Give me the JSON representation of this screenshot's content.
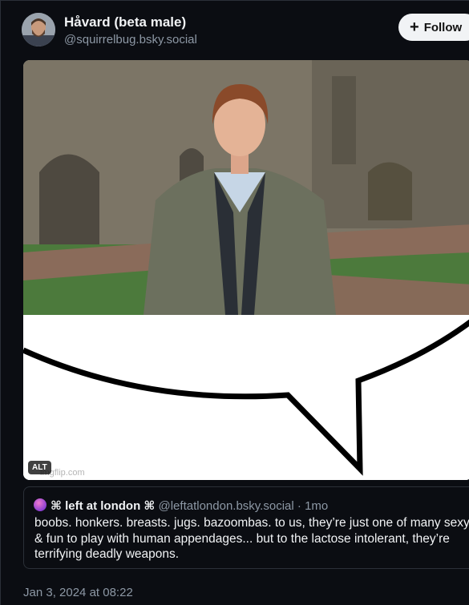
{
  "post": {
    "author": {
      "display_name": "Håvard (beta male)",
      "handle": "@squirrelbug.bsky.social"
    },
    "follow_label": "Follow",
    "media": {
      "alt_badge": "ALT",
      "watermark": "imgflip.com"
    },
    "quote": {
      "author_prefix": "⌘ left at london ⌘",
      "handle": "@leftatlondon.bsky.social",
      "age": "1mo",
      "text": "boobs. honkers. breasts. jugs. bazoombas. to us, they’re just one of many sexy & fun to play with human appendages... but to the lactose intolerant, they’re terrifying deadly weapons."
    },
    "timestamp": "Jan 3, 2024 at 08:22"
  },
  "colors": {
    "background": "#0b0d12",
    "muted_text": "#8d98a5",
    "border": "#2b3038"
  },
  "icons": [
    "avatar-photo",
    "plus-icon",
    "avatar-icon"
  ]
}
